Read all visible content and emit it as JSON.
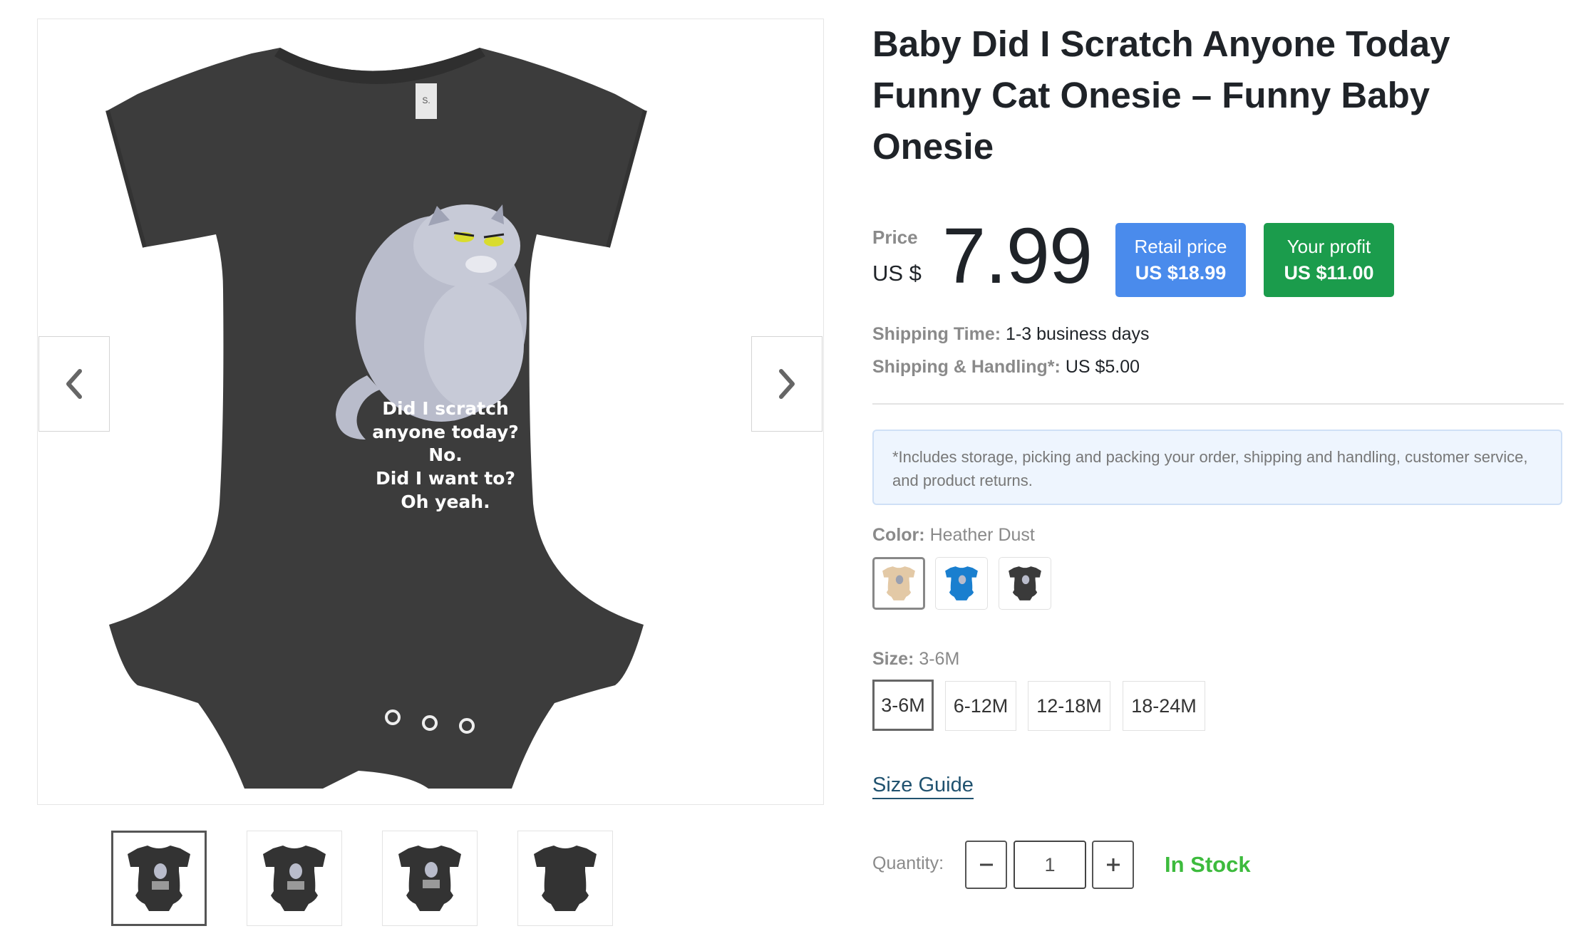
{
  "product": {
    "title": "Baby Did I Scratch Anyone Today Funny Cat Onesie – Funny Baby Onesie",
    "print_text": [
      "Did I scratch",
      "anyone today?",
      "No.",
      "Did I want to?",
      "Oh yeah."
    ]
  },
  "price": {
    "label": "Price",
    "currency": "US $",
    "value": "7.99",
    "retail": {
      "label": "Retail price",
      "value": "US $18.99",
      "color": "#4a8bec"
    },
    "profit": {
      "label": "Your profit",
      "value": "US $11.00",
      "color": "#1b9c4c"
    }
  },
  "shipping": {
    "time_label": "Shipping Time:",
    "time_value": "1-3 business days",
    "handling_label": "Shipping & Handling*:",
    "handling_value": "US $5.00",
    "note": "*Includes storage, picking and packing your order, shipping and handling, customer service, and product returns."
  },
  "color": {
    "label": "Color:",
    "selected": "Heather Dust",
    "swatches": [
      {
        "name": "Heather Dust",
        "hex": "#e3c9a6"
      },
      {
        "name": "Blue",
        "hex": "#1a7fcf"
      },
      {
        "name": "Dark Grey",
        "hex": "#3a3a3a"
      }
    ]
  },
  "size": {
    "label": "Size:",
    "selected": "3-6M",
    "options": [
      "3-6M",
      "6-12M",
      "12-18M",
      "18-24M"
    ]
  },
  "size_guide": "Size Guide",
  "quantity": {
    "label": "Quantity:",
    "value": "1"
  },
  "stock": "In Stock",
  "icons": {
    "prev": "chevron-left-icon",
    "next": "chevron-right-icon",
    "minus": "minus-icon",
    "plus": "plus-icon"
  }
}
